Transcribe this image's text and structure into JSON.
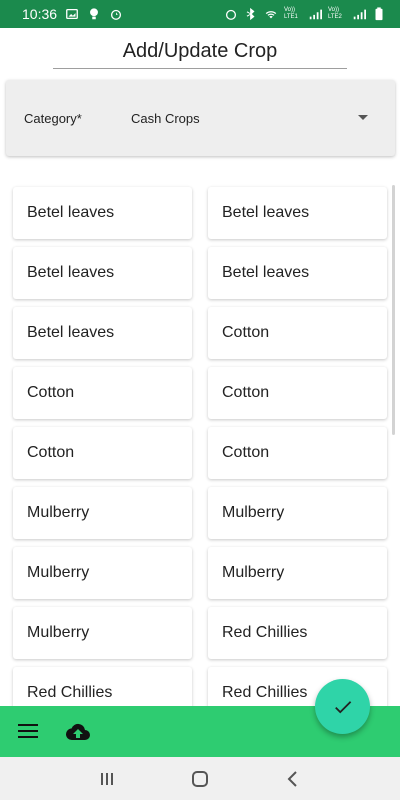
{
  "status_bar": {
    "time": "10:36",
    "network_labels": [
      "Vo)) LTE1",
      "Vo)) LTE2"
    ]
  },
  "header": {
    "title": "Add/Update Crop"
  },
  "category": {
    "label": "Category*",
    "value": "Cash Crops"
  },
  "crops": [
    "Betel leaves",
    "Betel leaves",
    "Betel leaves",
    "Betel leaves",
    "Betel leaves",
    "Cotton",
    "Cotton",
    "Cotton",
    "Cotton",
    "Cotton",
    "Mulberry",
    "Mulberry",
    "Mulberry",
    "Mulberry",
    "Mulberry",
    "Red Chillies",
    "Red Chillies",
    "Red Chillies"
  ],
  "colors": {
    "status_bar": "#1b8a4d",
    "bottom_bar": "#2ecc71",
    "fab": "#2fd4a8"
  },
  "icons": {
    "menu": "menu-icon",
    "upload": "cloud-upload-icon",
    "fab": "check-icon"
  }
}
